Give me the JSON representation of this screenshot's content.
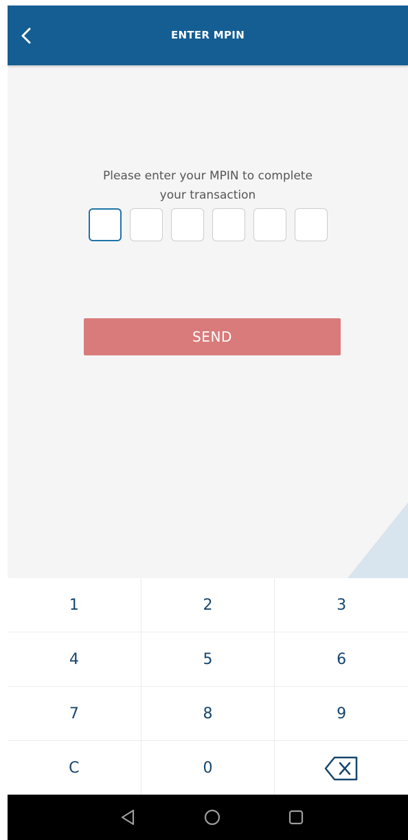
{
  "header": {
    "title": "ENTER MPIN",
    "back_icon": "chevron-left-icon"
  },
  "prompt": {
    "line1": "Please enter your MPIN to complete",
    "line2": "your transaction"
  },
  "pin": {
    "length": 6,
    "filled": 0,
    "active_index": 0
  },
  "send_button": {
    "label": "SEND"
  },
  "keypad": {
    "rows": [
      [
        "1",
        "2",
        "3"
      ],
      [
        "4",
        "5",
        "6"
      ],
      [
        "7",
        "8",
        "9"
      ],
      [
        "C",
        "0",
        "backspace-icon"
      ]
    ]
  },
  "nav_bar": {
    "buttons": [
      "back-triangle-icon",
      "home-circle-icon",
      "recents-square-icon"
    ]
  },
  "colors": {
    "header_bg": "#155e93",
    "send_button_bg": "#d97b7b",
    "key_text": "#15456e",
    "active_border": "#1e73a8"
  }
}
